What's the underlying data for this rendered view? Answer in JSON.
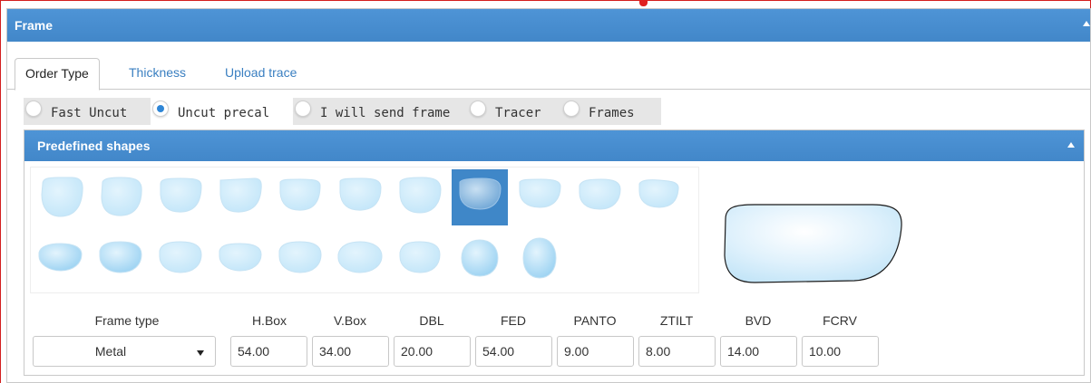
{
  "panel": {
    "title": "Frame"
  },
  "tabs": [
    {
      "label": "Order Type",
      "active": true
    },
    {
      "label": "Thickness",
      "active": false
    },
    {
      "label": "Upload trace",
      "active": false
    }
  ],
  "order_options": [
    {
      "label": "Fast Uncut",
      "checked": false
    },
    {
      "label": "Uncut precal",
      "checked": true
    },
    {
      "label": "I will send frame",
      "checked": false
    },
    {
      "label": "Tracer",
      "checked": false
    },
    {
      "label": "Frames",
      "checked": false
    }
  ],
  "shapes_panel": {
    "title": "Predefined shapes",
    "selected_index": 7,
    "shape_count": 20
  },
  "fields": {
    "frame_type": {
      "label": "Frame type",
      "value": "Metal"
    },
    "hbox": {
      "label": "H.Box",
      "value": "54.00"
    },
    "vbox": {
      "label": "V.Box",
      "value": "34.00"
    },
    "dbl": {
      "label": "DBL",
      "value": "20.00"
    },
    "fed": {
      "label": "FED",
      "value": "54.00"
    },
    "panto": {
      "label": "PANTO",
      "value": "9.00"
    },
    "ztilt": {
      "label": "ZTILT",
      "value": "8.00"
    },
    "bvd": {
      "label": "BVD",
      "value": "14.00"
    },
    "fcrv": {
      "label": "FCRV",
      "value": "10.00"
    }
  },
  "colors": {
    "header": "#4287c9",
    "selected_shape": "#3f87c8",
    "lens_light": "#e3f4fd",
    "lens_dark": "#9bd2f2",
    "red_border": "#d21e1e"
  },
  "icons": {
    "panel_collapse": "triangle-up-icon",
    "sub_collapse": "triangle-up-icon",
    "select_arrow": "triangle-down-icon"
  }
}
